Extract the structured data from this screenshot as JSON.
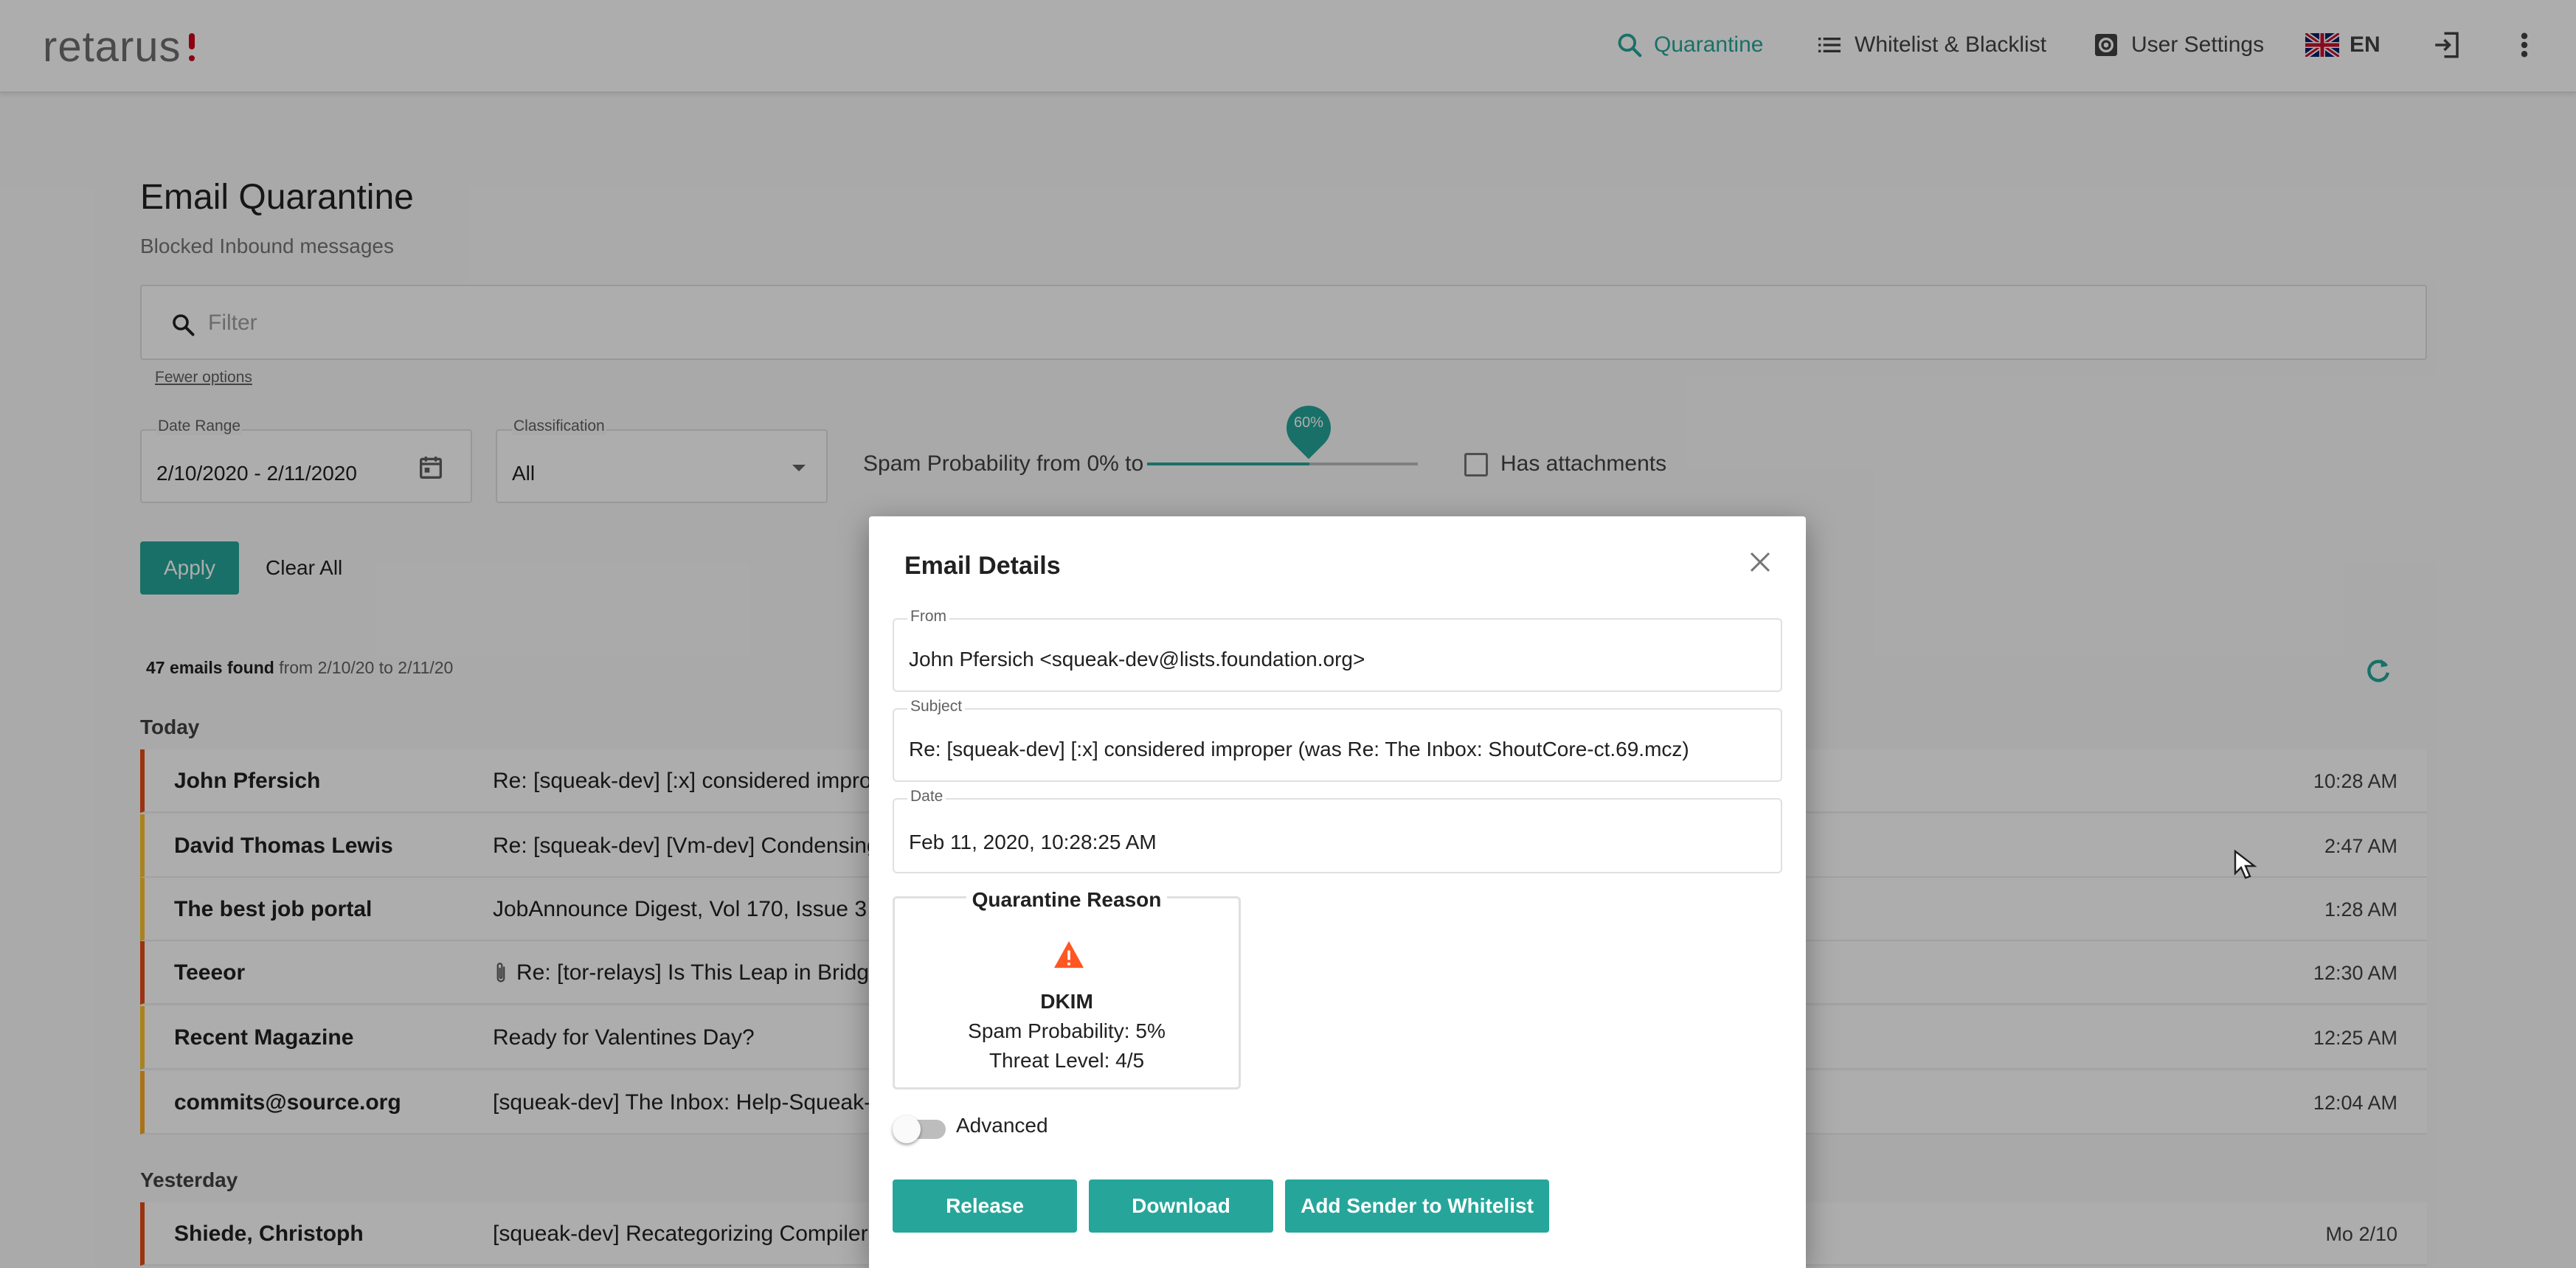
{
  "header": {
    "logo": "retarus",
    "nav": {
      "quarantine": "Quarantine",
      "whitelist": "Whitelist & Blacklist",
      "user_settings": "User Settings",
      "language": "EN"
    }
  },
  "page": {
    "title": "Email Quarantine",
    "subtitle": "Blocked Inbound messages"
  },
  "filter": {
    "placeholder": "Filter",
    "fewer_options": "Fewer options",
    "date_range": {
      "label": "Date Range",
      "value": "2/10/2020 - 2/11/2020"
    },
    "classification": {
      "label": "Classification",
      "value": "All"
    },
    "spam_probability": {
      "label": "Spam Probability from 0% to",
      "value_text": "60%",
      "value_percent": 60
    },
    "has_attachments": {
      "label": "Has attachments",
      "checked": false
    },
    "apply": "Apply",
    "clear_all": "Clear All"
  },
  "results": {
    "count": "47 emails found",
    "range": "from 2/10/20 to 2/11/20"
  },
  "groups": {
    "today": "Today",
    "yesterday": "Yesterday"
  },
  "emails": [
    {
      "sender": "John Pfersich",
      "subject": "Re: [squeak-dev] [:x] considered improper",
      "time": "10:28 AM",
      "severity": "red",
      "attachment": false
    },
    {
      "sender": "David Thomas Lewis",
      "subject": "Re: [squeak-dev] [Vm-dev] Condensing so",
      "time": "2:47 AM",
      "severity": "yellow",
      "attachment": false
    },
    {
      "sender": "The best job portal",
      "subject": "JobAnnounce Digest, Vol 170, Issue 3",
      "time": "1:28 AM",
      "severity": "yellow",
      "attachment": false
    },
    {
      "sender": "Teeeor",
      "subject": "Re: [tor-relays] Is This Leap in Bridge C",
      "time": "12:30 AM",
      "severity": "red",
      "attachment": true
    },
    {
      "sender": "Recent Magazine",
      "subject": "Ready for Valentines Day?",
      "time": "12:25 AM",
      "severity": "yellow",
      "attachment": false
    },
    {
      "sender": "commits@source.org",
      "subject": "[squeak-dev] The Inbox: Help-Squeak-Proj",
      "time": "12:04 AM",
      "severity": "orange",
      "attachment": false
    },
    {
      "sender": "Shiede, Christoph",
      "subject": "[squeak-dev] Recategorizing Compiler-Exc",
      "time": "Mo 2/10",
      "severity": "red",
      "attachment": false
    }
  ],
  "modal": {
    "title": "Email Details",
    "from": {
      "label": "From",
      "value": "John Pfersich <squeak-dev@lists.foundation.org>"
    },
    "subject": {
      "label": "Subject",
      "value": "Re: [squeak-dev] [:x] considered improper (was Re: The Inbox:   ShoutCore-ct.69.mcz)"
    },
    "date": {
      "label": "Date",
      "value": "Feb 11, 2020, 10:28:25 AM"
    },
    "reason": {
      "title": "Quarantine Reason",
      "type": "DKIM",
      "spam": "Spam Probability: 5%",
      "threat": "Threat Level: 4/5"
    },
    "advanced": "Advanced",
    "buttons": {
      "release": "Release",
      "download": "Download",
      "whitelist": "Add Sender to Whitelist"
    }
  },
  "colors": {
    "accent": "#26a69a",
    "severity_red": "#e64a19",
    "severity_yellow": "#fbc02d",
    "warning": "#ff5722"
  }
}
